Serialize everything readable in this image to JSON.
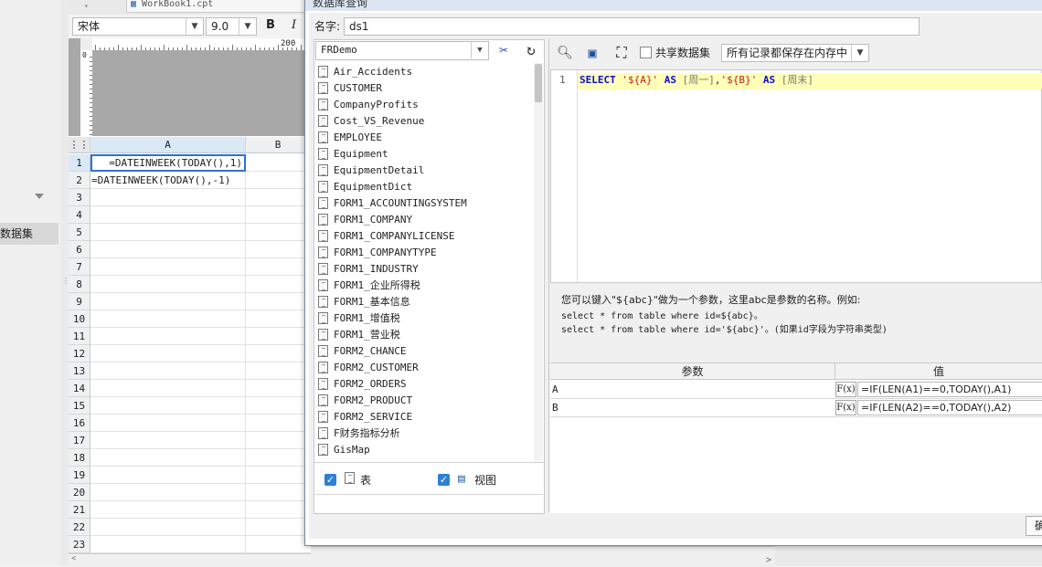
{
  "designer": {
    "file_tab": "WorkBook1.cpt",
    "font_name": "宋体",
    "font_size": "9.0",
    "bold_label": "B",
    "italic_label": "I",
    "ruler_label_200": "200",
    "ruler_label_0": "0",
    "columns": [
      "A",
      "B"
    ],
    "rows": [
      "1",
      "2",
      "3",
      "4",
      "5",
      "6",
      "7",
      "8",
      "9",
      "10",
      "11",
      "12",
      "13",
      "14",
      "15",
      "16",
      "17",
      "18",
      "19",
      "20",
      "21",
      "22",
      "23"
    ],
    "cell_a1": "=DATEINWEEK(TODAY(),1)",
    "cell_a2": "=DATEINWEEK(TODAY(),-1)"
  },
  "left_panel": {
    "dataset_label": "数据集"
  },
  "dialog": {
    "title": "数据库查询",
    "name_label": "名字:",
    "name_value": "ds1",
    "database": "FRDemo",
    "tables": [
      "Air_Accidents",
      "CUSTOMER",
      "CompanyProfits",
      "Cost_VS_Revenue",
      "EMPLOYEE",
      "Equipment",
      "EquipmentDetail",
      "EquipmentDict",
      "FORM1_ACCOUNTINGSYSTEM",
      "FORM1_COMPANY",
      "FORM1_COMPANYLICENSE",
      "FORM1_COMPANYTYPE",
      "FORM1_INDUSTRY",
      "FORM1_企业所得税",
      "FORM1_基本信息",
      "FORM1_增值税",
      "FORM1_营业税",
      "FORM2_CHANCE",
      "FORM2_CUSTOMER",
      "FORM2_ORDERS",
      "FORM2_PRODUCT",
      "FORM2_SERVICE",
      "F财务指标分析",
      "GisMap"
    ],
    "filter_table_label": "表",
    "filter_view_label": "视图",
    "share_dataset_label": "共享数据集",
    "memory_option": "所有记录都保存在内存中",
    "sql": {
      "line_number": "1",
      "t1": "SELECT",
      "t2": "'${A}'",
      "t3": "AS",
      "t4": "[周一]",
      "t5": ",",
      "t6": "'${B}'",
      "t7": "AS",
      "t8": "[周末]"
    },
    "hint": {
      "line1": "您可以键入\"${abc}\"做为一个参数，这里abc是参数的名称。例如:",
      "line2": "select * from table where id=${abc}。",
      "line3": "select * from table where id='${abc}'。(如果id字段为字符串类型)"
    },
    "params": {
      "header_name": "参数",
      "header_value": "值",
      "fx_label": "F(x)",
      "rows": [
        {
          "name": "A",
          "value": "=IF(LEN(A1)==0,TODAY(),A1)"
        },
        {
          "name": "B",
          "value": "=IF(LEN(A2)==0,TODAY(),A2)"
        }
      ]
    },
    "ok_label": "确"
  }
}
